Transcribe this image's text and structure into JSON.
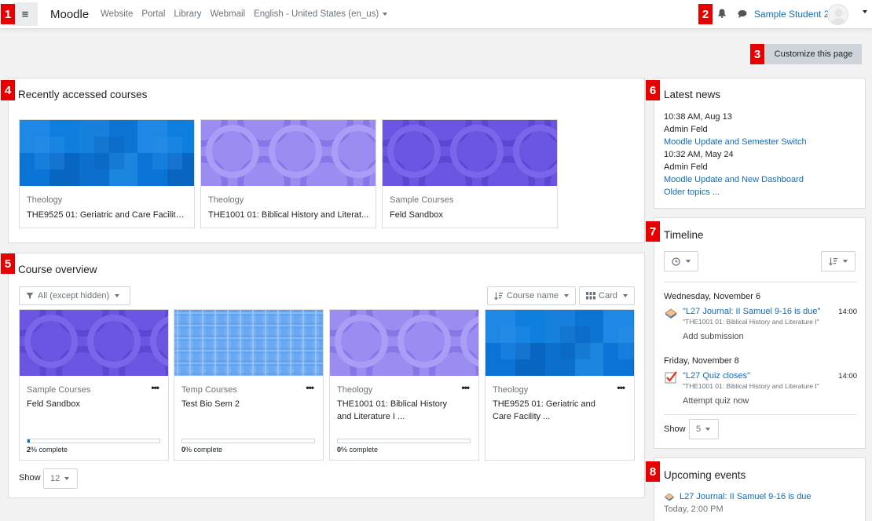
{
  "nav": {
    "brand": "Moodle",
    "links": [
      "Website",
      "Portal",
      "Library",
      "Webmail"
    ],
    "language": "English - United States (en_us)",
    "user_name": "Sample Student 2"
  },
  "badges": [
    "1",
    "2",
    "3",
    "4",
    "5",
    "6",
    "7",
    "8"
  ],
  "customize_label": "Customize this page",
  "recent": {
    "title": "Recently accessed courses",
    "courses": [
      {
        "category": "Theology",
        "name": "THE9525 01: Geriatric and Care Facility ...",
        "pattern": "blue-squares"
      },
      {
        "category": "Theology",
        "name": "THE1001 01: Biblical History and Literat...",
        "pattern": "lilac-circles"
      },
      {
        "category": "Sample Courses",
        "name": "Feld Sandbox",
        "pattern": "purple-circles"
      }
    ]
  },
  "overview": {
    "title": "Course overview",
    "filter_label": "All (except hidden)",
    "sort_label": "Course name",
    "view_label": "Card",
    "show_label": "Show",
    "show_value": "12",
    "courses": [
      {
        "category": "Sample Courses",
        "name_lines": [
          "Feld Sandbox"
        ],
        "progress_pct": "2",
        "progress_label": "% complete",
        "progress": 0.02,
        "pattern": "purple-circles"
      },
      {
        "category": "Temp Courses",
        "name_lines": [
          "Test Bio Sem 2"
        ],
        "progress_pct": "0",
        "progress_label": "% complete",
        "progress": 0,
        "pattern": "light-blue-plaid"
      },
      {
        "category": "Theology",
        "name_lines": [
          "THE1001 01: Biblical History",
          "and Literature I ..."
        ],
        "progress_pct": "0",
        "progress_label": "% complete",
        "progress": 0,
        "pattern": "lilac-circles"
      },
      {
        "category": "Theology",
        "name_lines": [
          "THE9525 01: Geriatric and",
          "Care Facility ..."
        ],
        "progress_pct": "",
        "progress_label": "",
        "progress": null,
        "pattern": "blue-squares"
      }
    ]
  },
  "news": {
    "title": "Latest news",
    "items": [
      {
        "time": "10:38 AM, Aug 13",
        "author": "Admin Feld",
        "subject": "Moodle Update and Semester Switch"
      },
      {
        "time": "10:32 AM, May 24",
        "author": "Admin Feld",
        "subject": "Moodle Update and New Dashboard"
      }
    ],
    "older": "Older topics ..."
  },
  "timeline": {
    "title": "Timeline",
    "groups": [
      {
        "date": "Wednesday, November 6",
        "title": "\"L27 Journal: II Samuel 9-16 is due\"",
        "course": "\"THE1001 01: Biblical History and Literature I\"",
        "time": "14:00",
        "action": "Add submission",
        "icon": "assignment-icon"
      },
      {
        "date": "Friday, November 8",
        "title": "\"L27 Quiz closes\"",
        "course": "\"THE1001 01: Biblical History and Literature I\"",
        "time": "14:00",
        "action": "Attempt quiz now",
        "icon": "quiz-icon"
      }
    ],
    "show_label": "Show",
    "show_value": "5"
  },
  "upcoming": {
    "title": "Upcoming events",
    "event_title": "L27 Journal: II Samuel 9-16 is due",
    "event_time": "Today, 2:00 PM"
  },
  "colors": {
    "link": "#0f6cbf",
    "badge": "#e80000",
    "progress": "#0f6cbf"
  }
}
